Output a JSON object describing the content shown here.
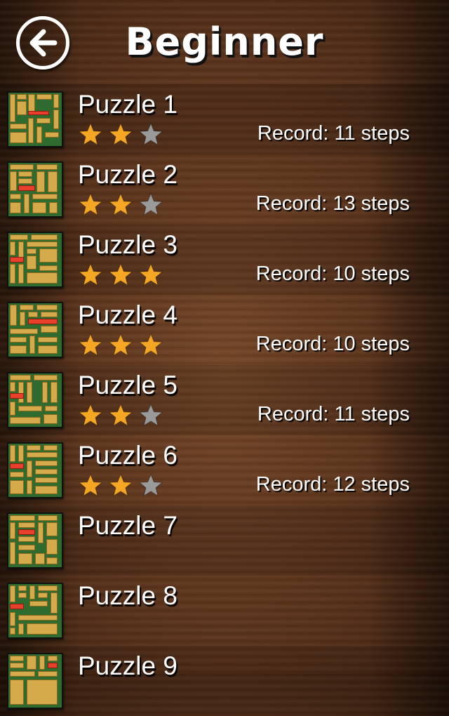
{
  "header": {
    "title": "Beginner",
    "back_icon": "back-arrow-icon"
  },
  "colors": {
    "star_filled": "#f5a623",
    "star_empty": "#9a9a9a",
    "board": "#2f6b2e",
    "block": "#d4aa4a",
    "target_block": "#e8402a"
  },
  "puzzles": [
    {
      "name": "Puzzle 1",
      "stars": 2,
      "record": "Record: 11 steps"
    },
    {
      "name": "Puzzle 2",
      "stars": 2,
      "record": "Record: 13 steps"
    },
    {
      "name": "Puzzle 3",
      "stars": 3,
      "record": "Record: 10 steps"
    },
    {
      "name": "Puzzle 4",
      "stars": 3,
      "record": "Record: 10 steps"
    },
    {
      "name": "Puzzle 5",
      "stars": 2,
      "record": "Record: 11 steps"
    },
    {
      "name": "Puzzle 6",
      "stars": 2,
      "record": "Record: 12 steps"
    },
    {
      "name": "Puzzle 7",
      "stars": 0,
      "record": ""
    },
    {
      "name": "Puzzle 8",
      "stars": 0,
      "record": ""
    },
    {
      "name": "Puzzle 9",
      "stars": 0,
      "record": ""
    }
  ]
}
